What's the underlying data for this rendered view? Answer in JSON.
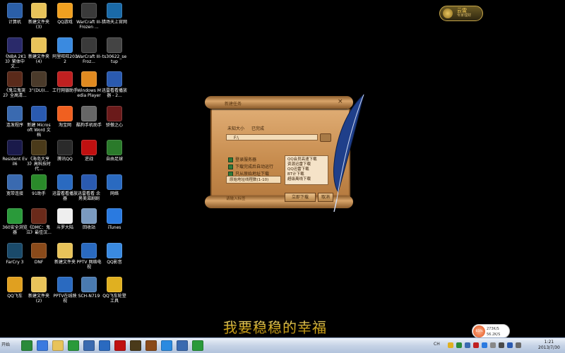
{
  "desktop": {
    "icons": [
      {
        "label": "计算机",
        "color": "#2b5fa8",
        "icon": "computer-icon"
      },
      {
        "label": "新建文件夹 (3)",
        "color": "#e8c35a",
        "icon": "folder-icon"
      },
      {
        "label": "QQ游戏",
        "color": "#f0a020",
        "icon": "qq-game-icon"
      },
      {
        "label": "WarCraft III-Frozen ...",
        "color": "#3a3a3a",
        "icon": "warcraft-icon"
      },
      {
        "label": "猎场天上官网",
        "color": "#1a6aa8",
        "icon": "app-icon"
      },
      {
        "label": "《NBA 2K13》繁体中文...",
        "color": "#2a2a6a",
        "icon": "nba-icon"
      },
      {
        "label": "新建文件夹 (4)",
        "color": "#e8c35a",
        "icon": "folder-icon"
      },
      {
        "label": "阿里旺旺2012",
        "color": "#3a8ae0",
        "icon": "aliwangwang-icon"
      },
      {
        "label": "WarCraft III-Froz...",
        "color": "#3a3a3a",
        "icon": "warcraft-icon"
      },
      {
        "label": "ts30622_setup",
        "color": "#444444",
        "icon": "setup-icon"
      },
      {
        "label": "《鬼泣鬼哭2》全高清...",
        "color": "#5a2a1a",
        "icon": "game-icon"
      },
      {
        "label": "3”(DU)I...",
        "color": "#4a3a2a",
        "icon": "game-icon"
      },
      {
        "label": "工行网银助手",
        "color": "#c02020",
        "icon": "icbc-icon"
      },
      {
        "label": "Windows Media Player",
        "color": "#e08a20",
        "icon": "media-player-icon"
      },
      {
        "label": "迅雷看看播放器 - 2...",
        "color": "#2a5ab0",
        "icon": "player-icon"
      },
      {
        "label": "连发程序",
        "color": "#3a6ab0",
        "icon": "app-icon"
      },
      {
        "label": "新建 Microsoft Word 文档",
        "color": "#2a5ab0",
        "icon": "word-icon"
      },
      {
        "label": "淘宝网",
        "color": "#f06020",
        "icon": "taobao-icon"
      },
      {
        "label": "酷狗手机助手",
        "color": "#666666",
        "icon": "kugou-icon"
      },
      {
        "label": "骄傲之心",
        "color": "#6a1a1a",
        "icon": "game-icon"
      },
      {
        "label": "Resident Evil6",
        "color": "#1a1a4a",
        "icon": "game-icon"
      },
      {
        "label": "《海岛大亨3》高科技时代...",
        "color": "#4a3a1a",
        "icon": "game-icon"
      },
      {
        "label": "腾讯QQ",
        "color": "#2a2a2a",
        "icon": "qq-icon"
      },
      {
        "label": "逆战",
        "color": "#c01010",
        "icon": "nizhan-icon"
      },
      {
        "label": "自由足球",
        "color": "#2a7a2a",
        "icon": "football-icon"
      },
      {
        "label": "宽带连接",
        "color": "#3a6ab0",
        "icon": "network-icon"
      },
      {
        "label": "91助手",
        "color": "#2a8a2a",
        "icon": "app-icon"
      },
      {
        "label": "迅雷看看播放器",
        "color": "#2a6ac0",
        "icon": "player-icon"
      },
      {
        "label": "迅雷看看 余男美滋剧剧",
        "color": "#2a5ab0",
        "icon": "player-icon"
      },
      {
        "label": "网络",
        "color": "#2a6ac0",
        "icon": "globe-icon"
      },
      {
        "label": "360安全浏览器",
        "color": "#2a9a3a",
        "icon": "browser-icon"
      },
      {
        "label": "《DMC：鬼泣》最佳汉...",
        "color": "#6a2a1a",
        "icon": "game-icon"
      },
      {
        "label": "斗罗大陆",
        "color": "#eeeeee",
        "icon": "document-icon"
      },
      {
        "label": "回收站",
        "color": "#7a9ac0",
        "icon": "recycle-bin-icon"
      },
      {
        "label": "iTunes",
        "color": "#2a7ae0",
        "icon": "itunes-icon"
      },
      {
        "label": "FarCry 3",
        "color": "#1a4a6a",
        "icon": "farcry-icon"
      },
      {
        "label": "DNF",
        "color": "#8a4a1a",
        "icon": "dnf-icon"
      },
      {
        "label": "新建文件夹",
        "color": "#e8c35a",
        "icon": "folder-icon"
      },
      {
        "label": "PPTV 网络电视",
        "color": "#2a6ac0",
        "icon": "pptv-icon"
      },
      {
        "label": "QQ影音",
        "color": "#3a8ae0",
        "icon": "qq-player-icon"
      },
      {
        "label": "QQ飞车",
        "color": "#e0a020",
        "icon": "qq-speed-icon"
      },
      {
        "label": "新建文件夹 (2)",
        "color": "#e8c35a",
        "icon": "folder-icon"
      },
      {
        "label": "PPTV在线映视",
        "color": "#2a6ac0",
        "icon": "pptv-icon"
      },
      {
        "label": "SCH-N719",
        "color": "#4a7ab0",
        "icon": "phone-icon"
      },
      {
        "label": "QQ飞车轮登工具",
        "color": "#e0b020",
        "icon": "qq-speed-icon"
      }
    ]
  },
  "corner_badge": {
    "title": "云雷",
    "subtitle": "专家理财"
  },
  "download_dialog": {
    "title": "新建任务",
    "close": "×",
    "size_label": "未知大小",
    "completed_label": "已完成",
    "path": "F:\\",
    "options": [
      "登录服务器",
      "下载完成后自动运行",
      "只从原始地址下载"
    ],
    "thread_label": "原始地址线程数(1-10)",
    "servers": [
      "QQ会员高速下载",
      "资源迅雷下载",
      "QQ迅雷下载",
      "BT计下载",
      "超级离线下载"
    ],
    "download_button": "立即下载",
    "cancel_button": "取消",
    "bottom_check": "请输入标签"
  },
  "lyric": "我要稳稳的幸福",
  "net_widget": {
    "percent": "65%",
    "upload": "273K/S",
    "download": "56.2K/S"
  },
  "taskbar": {
    "start_label": "开始",
    "apps": [
      {
        "name": "start-orb-icon",
        "color": "#2a8a3a"
      },
      {
        "name": "ie-icon",
        "color": "#3a7ae0"
      },
      {
        "name": "explorer-icon",
        "color": "#e8c35a"
      },
      {
        "name": "360-icon",
        "color": "#2a9a3a"
      },
      {
        "name": "thunder-icon",
        "color": "#3a6ab0"
      },
      {
        "name": "media-icon",
        "color": "#2a6ac0"
      },
      {
        "name": "nizhan-icon",
        "color": "#c01010"
      },
      {
        "name": "game-icon",
        "color": "#4a3a1a"
      },
      {
        "name": "dnf-icon",
        "color": "#8a4a1a"
      },
      {
        "name": "qq-icon",
        "color": "#2a8ae0"
      },
      {
        "name": "monitor-icon",
        "color": "#3a6ab0"
      },
      {
        "name": "browser-icon",
        "color": "#2a9a3a"
      }
    ],
    "tray_lang": "CH",
    "time": "1:21",
    "date": "2013/7/30"
  }
}
